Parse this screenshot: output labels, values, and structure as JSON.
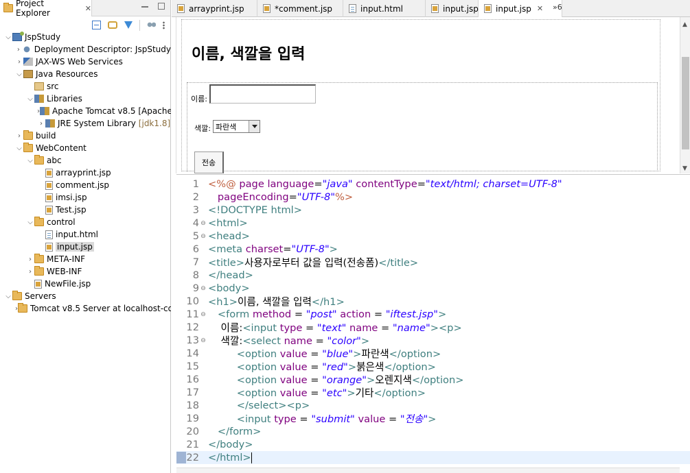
{
  "explorer": {
    "tab_label": "Project Explorer",
    "tree": [
      {
        "label": "JspStudy",
        "icon": "project-icon",
        "indent": 0,
        "twisty": "v"
      },
      {
        "label": "Deployment Descriptor: JspStudy",
        "icon": "descriptor-icon",
        "indent": 1,
        "twisty": ">"
      },
      {
        "label": "JAX-WS Web Services",
        "icon": "web-services-icon",
        "indent": 1,
        "twisty": ">"
      },
      {
        "label": "Java Resources",
        "icon": "java-resources-icon",
        "indent": 1,
        "twisty": "v"
      },
      {
        "label": "src",
        "icon": "package-folder-icon",
        "indent": 2,
        "twisty": ""
      },
      {
        "label": "Libraries",
        "icon": "library-icon",
        "indent": 2,
        "twisty": "v"
      },
      {
        "label": "Apache Tomcat v8.5 [Apache",
        "icon": "library-icon",
        "indent": 3,
        "twisty": ">"
      },
      {
        "label": "JRE System Library",
        "suffix": "[jdk1.8]",
        "icon": "library-icon",
        "indent": 3,
        "twisty": ">"
      },
      {
        "label": "build",
        "icon": "folder-icon",
        "indent": 1,
        "twisty": ">"
      },
      {
        "label": "WebContent",
        "icon": "folder-icon",
        "indent": 1,
        "twisty": "v"
      },
      {
        "label": "abc",
        "icon": "folder-icon",
        "indent": 2,
        "twisty": "v"
      },
      {
        "label": "arrayprint.jsp",
        "icon": "jsp-file-icon",
        "indent": 3,
        "twisty": ""
      },
      {
        "label": "comment.jsp",
        "icon": "jsp-file-icon",
        "indent": 3,
        "twisty": ""
      },
      {
        "label": "imsi.jsp",
        "icon": "jsp-file-icon",
        "indent": 3,
        "twisty": ""
      },
      {
        "label": "Test.jsp",
        "icon": "jsp-file-icon",
        "indent": 3,
        "twisty": ""
      },
      {
        "label": "control",
        "icon": "folder-icon",
        "indent": 2,
        "twisty": "v"
      },
      {
        "label": "input.html",
        "icon": "html-file-icon",
        "indent": 3,
        "twisty": ""
      },
      {
        "label": "input.jsp",
        "icon": "jsp-file-icon",
        "indent": 3,
        "twisty": "",
        "selected": true
      },
      {
        "label": "META-INF",
        "icon": "folder-icon",
        "indent": 2,
        "twisty": ">"
      },
      {
        "label": "WEB-INF",
        "icon": "folder-icon",
        "indent": 2,
        "twisty": ">"
      },
      {
        "label": "NewFile.jsp",
        "icon": "jsp-file-icon",
        "indent": 2,
        "twisty": ""
      },
      {
        "label": "Servers",
        "icon": "folder-icon",
        "indent": 0,
        "twisty": "v"
      },
      {
        "label": "Tomcat v8.5 Server at localhost-co",
        "icon": "folder-icon",
        "indent": 1,
        "twisty": ">"
      }
    ]
  },
  "editor_tabs": [
    {
      "label": "arrayprint.jsp",
      "icon": "jsp-file-icon"
    },
    {
      "label": "*comment.jsp",
      "icon": "jsp-file-icon"
    },
    {
      "label": "input.html",
      "icon": "html-file-icon"
    },
    {
      "label": "input.jsp",
      "icon": "jsp-file-icon"
    },
    {
      "label": "input.jsp",
      "icon": "jsp-file-icon",
      "active": true
    }
  ],
  "overflow_tabs": "»6",
  "preview": {
    "heading": "이름, 색깔을 입력",
    "name_label": "이름:",
    "color_label": "색깔:",
    "selected_color": "파란색",
    "submit_label": "전송"
  },
  "source_lines": [
    {
      "n": "1",
      "fold": "",
      "html": "<span class='t-jsp'>&lt;%@</span> <span class='t-attr'>page</span> <span class='t-attr'>language</span>=<span class='t-val'>\"java\"</span> <span class='t-attr'>contentType</span>=<span class='t-val'>\"text/html; charset=UTF-8\"</span>"
    },
    {
      "n": "2",
      "fold": "",
      "html": "   <span class='t-attr'>pageEncoding</span>=<span class='t-val'>\"UTF-8\"</span><span class='t-jsp'>%&gt;</span>"
    },
    {
      "n": "3",
      "fold": "",
      "html": "<span class='t-tag'>&lt;!DOCTYPE html&gt;</span>"
    },
    {
      "n": "4",
      "fold": "⊖",
      "html": "<span class='t-tag'>&lt;html&gt;</span>"
    },
    {
      "n": "5",
      "fold": "⊖",
      "html": "<span class='t-tag'>&lt;head&gt;</span>"
    },
    {
      "n": "6",
      "fold": "",
      "html": "<span class='t-tag'>&lt;meta</span> <span class='t-attr'>charset</span>=<span class='t-val'>\"UTF-8\"</span><span class='t-tag'>&gt;</span>"
    },
    {
      "n": "7",
      "fold": "",
      "html": "<span class='t-tag'>&lt;title&gt;</span>사용자로부터 값을 입력(전송폼)<span class='t-tag'>&lt;/title&gt;</span>"
    },
    {
      "n": "8",
      "fold": "",
      "html": "<span class='t-tag'>&lt;/head&gt;</span>"
    },
    {
      "n": "9",
      "fold": "⊖",
      "html": "<span class='t-tag'>&lt;body&gt;</span>"
    },
    {
      "n": "10",
      "fold": "",
      "html": "<span class='t-tag'>&lt;h1&gt;</span>이름, 색깔을 입력<span class='t-tag'>&lt;/h1&gt;</span>"
    },
    {
      "n": "11",
      "fold": "⊖",
      "html": "   <span class='t-tag'>&lt;form</span> <span class='t-attr'>method</span> = <span class='t-val'>\"post\"</span> <span class='t-attr'>action</span> = <span class='t-val'>\"iftest.jsp\"</span><span class='t-tag'>&gt;</span>"
    },
    {
      "n": "12",
      "fold": "",
      "html": "    이름:<span class='t-tag'>&lt;input</span> <span class='t-attr'>type</span> = <span class='t-val'>\"text\"</span> <span class='t-attr'>name</span> = <span class='t-val'>\"name\"</span><span class='t-tag'>&gt;&lt;p&gt;</span>"
    },
    {
      "n": "13",
      "fold": "⊖",
      "html": "    색깔:<span class='t-tag'>&lt;select</span> <span class='t-attr'>name</span> = <span class='t-val'>\"color\"</span><span class='t-tag'>&gt;</span>"
    },
    {
      "n": "14",
      "fold": "",
      "html": "         <span class='t-tag'>&lt;option</span> <span class='t-attr'>value</span> = <span class='t-val'>\"blue\"</span><span class='t-tag'>&gt;</span>파란색<span class='t-tag'>&lt;/option&gt;</span>"
    },
    {
      "n": "15",
      "fold": "",
      "html": "         <span class='t-tag'>&lt;option</span> <span class='t-attr'>value</span> = <span class='t-val'>\"red\"</span><span class='t-tag'>&gt;</span>붉은색<span class='t-tag'>&lt;/option&gt;</span>"
    },
    {
      "n": "16",
      "fold": "",
      "html": "         <span class='t-tag'>&lt;option</span> <span class='t-attr'>value</span> = <span class='t-val'>\"orange\"</span><span class='t-tag'>&gt;</span>오렌지색<span class='t-tag'>&lt;/option&gt;</span>"
    },
    {
      "n": "17",
      "fold": "",
      "html": "         <span class='t-tag'>&lt;option</span> <span class='t-attr'>value</span> = <span class='t-val'>\"etc\"</span><span class='t-tag'>&gt;</span>기타<span class='t-tag'>&lt;/option&gt;</span>"
    },
    {
      "n": "18",
      "fold": "",
      "html": "         <span class='t-tag'>&lt;/select&gt;&lt;p&gt;</span>"
    },
    {
      "n": "19",
      "fold": "",
      "html": "         <span class='t-tag'>&lt;input</span> <span class='t-attr'>type</span> = <span class='t-val'>\"submit\"</span> <span class='t-attr'>value</span> = <span class='t-val'>\"전송\"</span><span class='t-tag'>&gt;</span>"
    },
    {
      "n": "20",
      "fold": "",
      "html": "   <span class='t-tag'>&lt;/form&gt;</span>"
    },
    {
      "n": "21",
      "fold": "",
      "html": "<span class='t-tag'>&lt;/body&gt;</span>"
    },
    {
      "n": "22",
      "fold": "",
      "html": "<span class='t-tag'>&lt;/html&gt;</span>",
      "current": true
    }
  ],
  "colors": {
    "tag": "#3f7f7f",
    "attr": "#7f007f",
    "value": "#2a00ff",
    "jsp": "#bf5f3f",
    "current_line": "#e8f2fe"
  }
}
